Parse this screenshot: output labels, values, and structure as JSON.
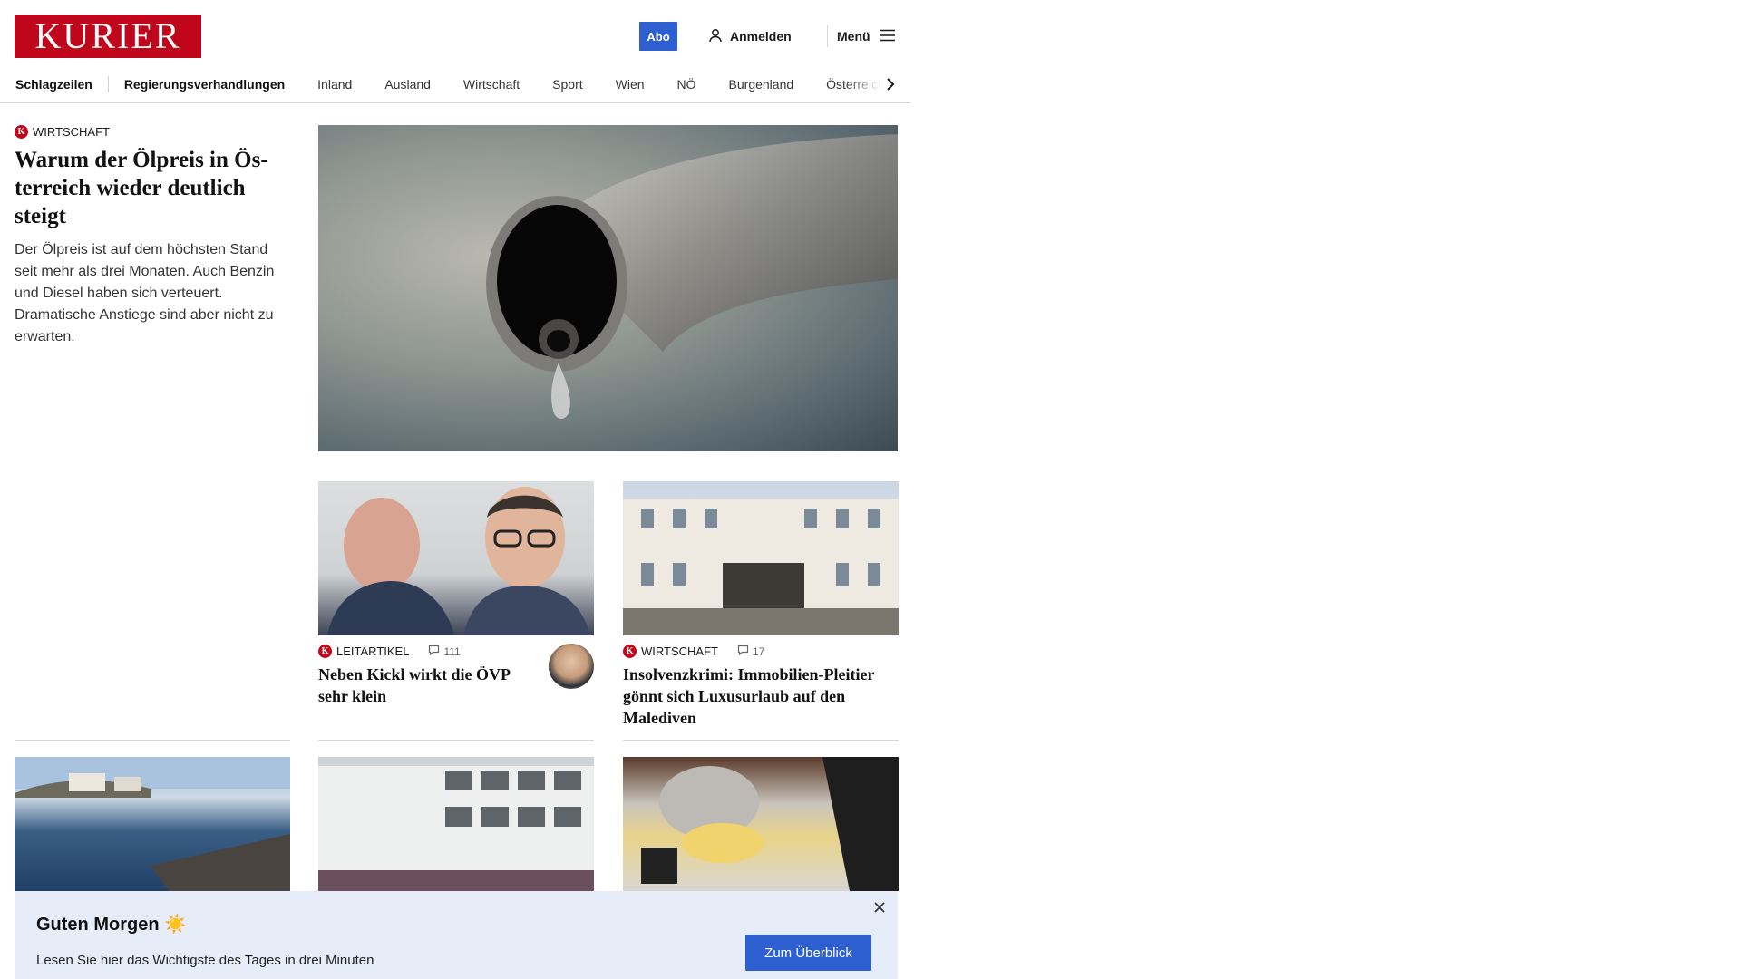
{
  "header": {
    "logo": "KURIER",
    "abo_label": "Abo",
    "login_label": "Anmelden",
    "menu_label": "Menü",
    "brand_color": "#c0061a",
    "accent_color": "#2d5fd0"
  },
  "nav": {
    "items": [
      "Schlagzeilen",
      "Regierungsverhandlungen",
      "Inland",
      "Ausland",
      "Wirtschaft",
      "Sport",
      "Wien",
      "NÖ",
      "Burgenland",
      "Österreich"
    ]
  },
  "lead": {
    "kicker": "WIRTSCHAFT",
    "title": "Warum der Ölpreis in Ös­terreich wieder deutlich steigt",
    "summary": "Der Ölpreis ist auf dem höchsten Stand seit mehr als drei Monaten. Auch Benzin und Diesel haben sich verteuert. Dramatische Anstiege sind aber nicht zu erwarten."
  },
  "stories": [
    {
      "kicker": "LEITARTIKEL",
      "comments": "111",
      "title": "Neben Kickl wirkt die ÖVP sehr klein"
    },
    {
      "kicker": "WIRTSCHAFT",
      "comments": "17",
      "title": "Insolvenzkrimi: Immobilien-Plei­tier gönnt sich Luxusurlaub auf den Malediven"
    }
  ],
  "banner": {
    "title": "Guten Morgen ☀️",
    "text": "Lesen Sie hier das Wichtigste des Tages in drei Minuten",
    "button": "Zum Überblick"
  }
}
